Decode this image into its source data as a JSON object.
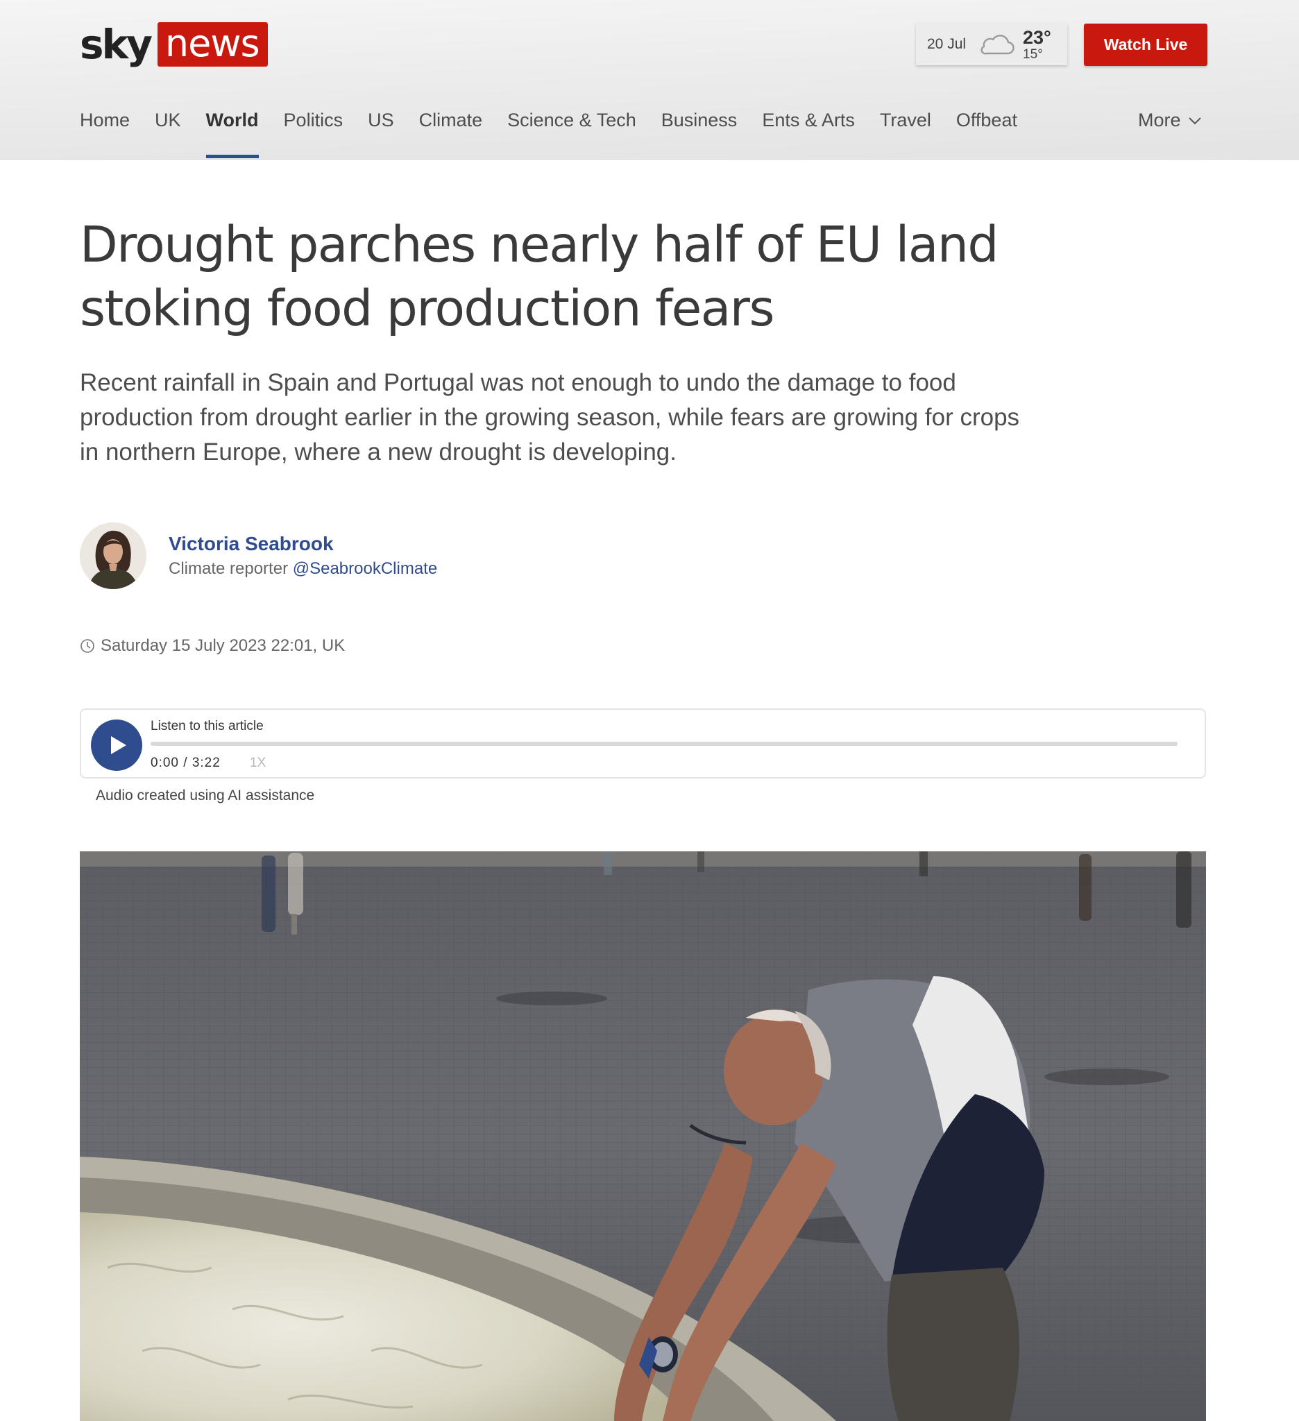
{
  "header": {
    "logo": {
      "sky": "sky",
      "news": "news"
    },
    "weather": {
      "date": "20 Jul",
      "icon": "cloud-icon",
      "high": "23°",
      "low": "15°"
    },
    "watch_live_label": "Watch Live",
    "nav": {
      "items": [
        {
          "label": "Home"
        },
        {
          "label": "UK"
        },
        {
          "label": "World",
          "active": true
        },
        {
          "label": "Politics"
        },
        {
          "label": "US"
        },
        {
          "label": "Climate"
        },
        {
          "label": "Science & Tech"
        },
        {
          "label": "Business"
        },
        {
          "label": "Ents & Arts"
        },
        {
          "label": "Travel"
        },
        {
          "label": "Offbeat"
        }
      ],
      "more_label": "More"
    }
  },
  "article": {
    "headline": "Drought parches nearly half of EU land stoking food production fears",
    "standfirst": "Recent rainfall in Spain and Portugal was not enough to undo the damage to food production from drought earlier in the growing season, while fears are growing for crops in northern Europe, where a new drought is developing.",
    "author": {
      "name": "Victoria Seabrook",
      "role": "Climate reporter",
      "handle": "@SeabrookClimate"
    },
    "timestamp": "Saturday 15 July 2023 22:01, UK",
    "audio": {
      "title": "Listen to this article",
      "time": "0:00 / 3:22",
      "speed": "1X",
      "progress": 0,
      "note": "Audio created using AI assistance"
    }
  },
  "colors": {
    "brand_red": "#c9190f",
    "accent_blue": "#2f4c8f",
    "text_dark": "#3a3a3a"
  }
}
